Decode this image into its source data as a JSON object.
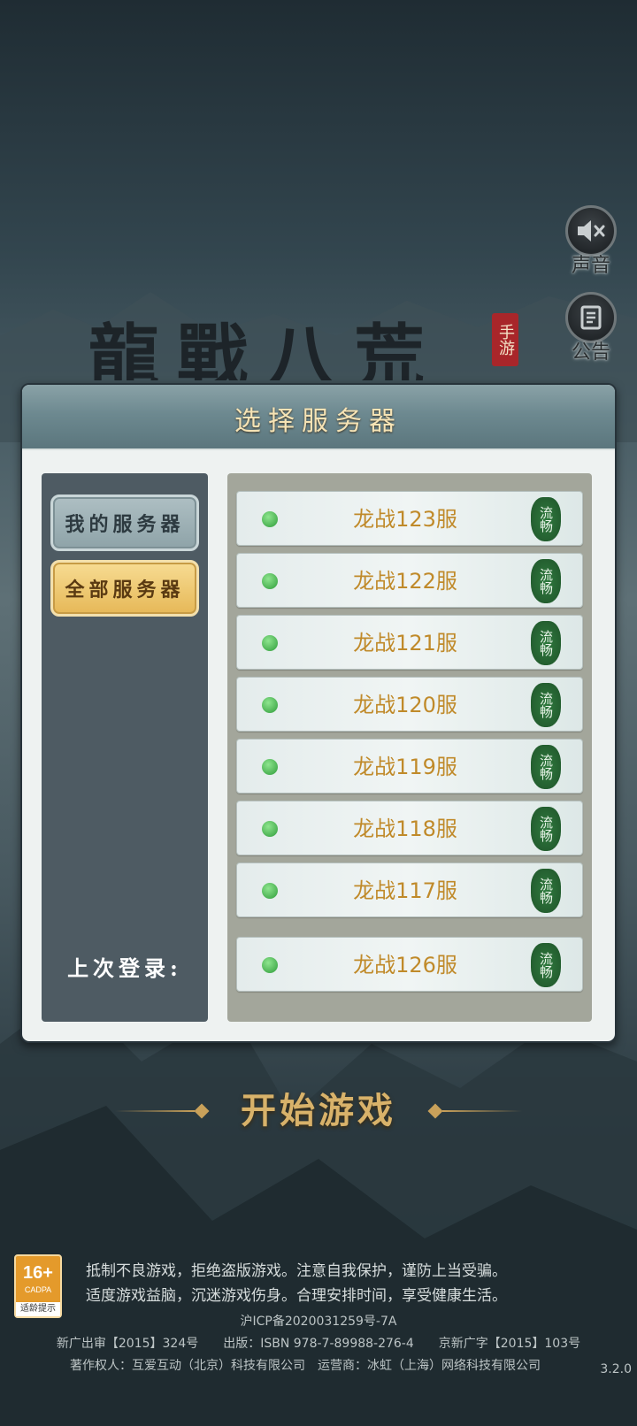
{
  "side_buttons": {
    "sound_label": "声音",
    "notice_label": "公告"
  },
  "logo": {
    "title": "龍戰八荒",
    "seal": "手游"
  },
  "panel": {
    "title": "选择服务器",
    "tabs": {
      "mine": "我的服务器",
      "all": "全部服务器"
    },
    "last_login_label": "上次登录:",
    "servers": [
      {
        "name": "龙战123服",
        "status": "流畅"
      },
      {
        "name": "龙战122服",
        "status": "流畅"
      },
      {
        "name": "龙战121服",
        "status": "流畅"
      },
      {
        "name": "龙战120服",
        "status": "流畅"
      },
      {
        "name": "龙战119服",
        "status": "流畅"
      },
      {
        "name": "龙战118服",
        "status": "流畅"
      },
      {
        "name": "龙战117服",
        "status": "流畅"
      }
    ],
    "last_server": {
      "name": "龙战126服",
      "status": "流畅"
    }
  },
  "start_button": "开始游戏",
  "age_rating": {
    "age": "16+",
    "org": "CADPA",
    "tip": "适龄提示"
  },
  "health_notice": {
    "line1": "抵制不良游戏，拒绝盗版游戏。注意自我保护，谨防上当受骗。",
    "line2": "适度游戏益脑，沉迷游戏伤身。合理安排时间，享受健康生活。"
  },
  "footer": {
    "icp": "沪ICP备2020031259号-7A",
    "approval": "新广出审【2015】324号　　出版：ISBN 978-7-89988-276-4　　京新广字【2015】103号",
    "copyright": "著作权人：互爱互动（北京）科技有限公司　运营商：冰虹（上海）网络科技有限公司"
  },
  "version": "3.2.0",
  "colors": {
    "online_dot": "#3aa845",
    "server_name": "#c08a2a",
    "status_badge": "#2f7a3e",
    "tab_active": "#e6b857"
  }
}
